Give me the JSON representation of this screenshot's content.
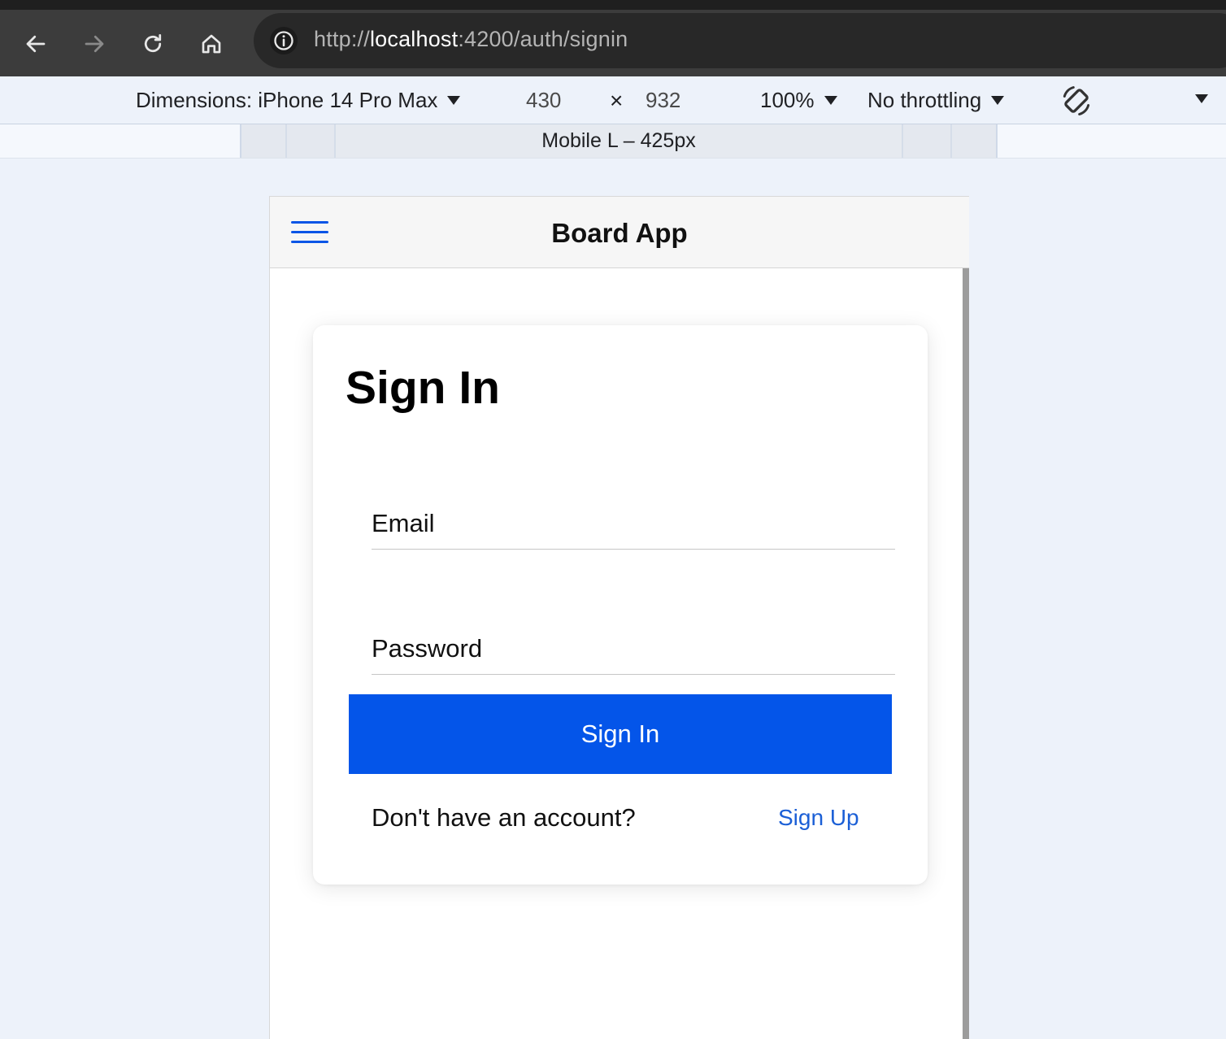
{
  "browser": {
    "url_prefix": "http://",
    "url_host": "localhost",
    "url_rest": ":4200/auth/signin",
    "icons": [
      "back-icon",
      "forward-icon",
      "reload-icon",
      "home-icon",
      "info-icon"
    ]
  },
  "device_toolbar": {
    "dimensions_label": "Dimensions: iPhone 14 Pro Max",
    "width": "430",
    "times": "×",
    "height": "932",
    "zoom": "100%",
    "throttling": "No throttling",
    "media_query_label": "Mobile L – 425px"
  },
  "app": {
    "title": "Board App",
    "signin": {
      "heading": "Sign In",
      "email_placeholder": "Email",
      "password_placeholder": "Password",
      "submit_label": "Sign In",
      "prompt": "Don't have an account?",
      "signup_link": "Sign Up"
    }
  },
  "colors": {
    "primary": "#0455e9",
    "link": "#1b5fd6",
    "browser_dark": "#3c3c3c"
  }
}
